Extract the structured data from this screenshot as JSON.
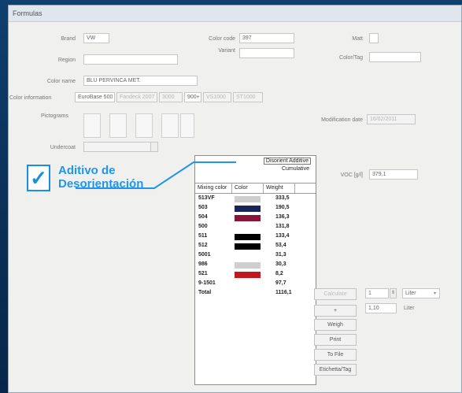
{
  "window": {
    "title": "Formulas"
  },
  "fields": {
    "brand": {
      "label": "Brand",
      "value": "VW"
    },
    "region": {
      "label": "Region",
      "value": ""
    },
    "color_code": {
      "label": "Color code",
      "value": "397"
    },
    "variant": {
      "label": "Variant",
      "value": ""
    },
    "matt": {
      "label": "Matt",
      "value": ""
    },
    "color_tag": {
      "label": "Color/Tag",
      "value": ""
    },
    "color_name": {
      "label": "Color name",
      "value": "BLU PERVINCA MET."
    },
    "color_information": {
      "label": "Color information",
      "values": [
        "EuroBase 500",
        "Fandeck 2007",
        "3000",
        "900+",
        "VS1000",
        "ST1000"
      ]
    },
    "pictograms": {
      "label": "Pictograms"
    },
    "undercoat": {
      "label": "Undercoat",
      "value": ""
    },
    "modification_date": {
      "label": "Modification date",
      "value": "16/02/2011"
    },
    "voc": {
      "label": "VOC [g/l]",
      "value": "379,1"
    }
  },
  "mixing_table": {
    "options": {
      "eco_additive_label": "Disorient Additive",
      "cumulative_label": "Cumulative"
    },
    "headers": {
      "mixing_color": "Mixing color",
      "color": "Color",
      "weight": "Weight"
    },
    "rows": [
      {
        "code": "513VF",
        "color": "#cfcfcf",
        "weight": "333,5"
      },
      {
        "code": "503",
        "color": "#1b2458",
        "weight": "190,5"
      },
      {
        "code": "504",
        "color": "#8a1338",
        "weight": "136,3"
      },
      {
        "code": "500",
        "color": "#ffffff",
        "weight": "131,8"
      },
      {
        "code": "511",
        "color": "#000000",
        "weight": "133,4"
      },
      {
        "code": "512",
        "color": "#000000",
        "weight": "53,4"
      },
      {
        "code": "5001",
        "color": "#ffffff",
        "weight": "31,3"
      },
      {
        "code": "986",
        "color": "#cfcfcf",
        "weight": "30,3"
      },
      {
        "code": "521",
        "color": "#c4171d",
        "weight": "8,2"
      },
      {
        "code": "9-1501",
        "color": "#ffffff",
        "weight": "97,7"
      }
    ],
    "total": {
      "label": "Total",
      "weight": "1116,1"
    }
  },
  "controls": {
    "calculate_label": "Calculate",
    "quantity": "1",
    "unit": "Liter",
    "plus_label": "+",
    "result_value": "1,10",
    "result_unit": "Liter",
    "weigh_label": "Weigh",
    "print_label": "Print",
    "to_file_label": "To File",
    "file_tag_label": "Etichetta/Tag"
  },
  "callout": {
    "line1": "Aditivo de",
    "line2": "Desorientación",
    "check_glyph": "✓",
    "color": "#1e96ea"
  }
}
